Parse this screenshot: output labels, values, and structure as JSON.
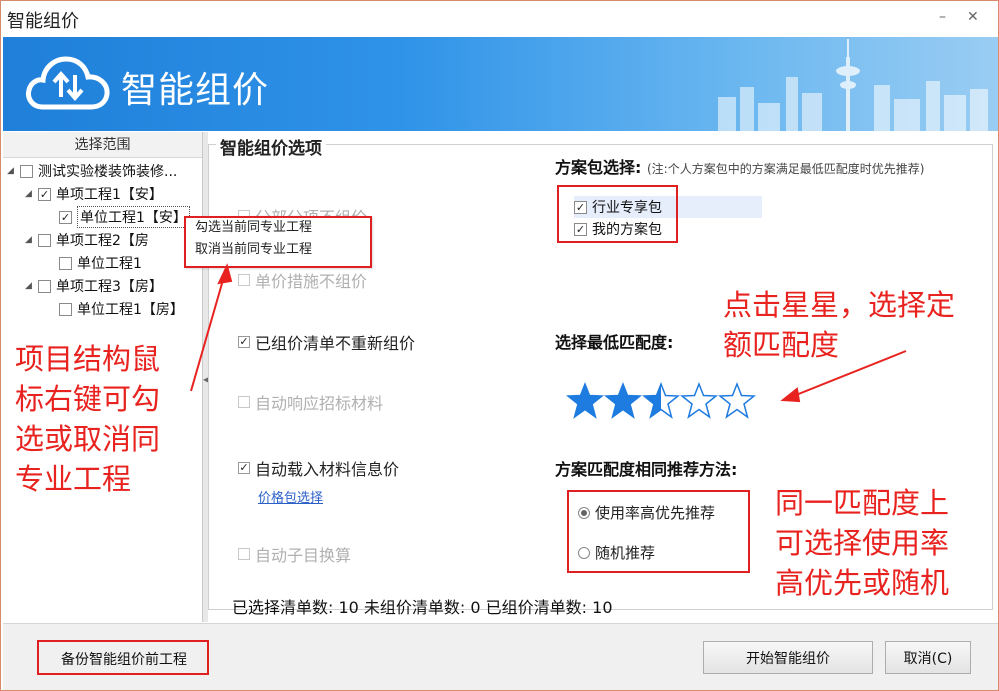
{
  "window": {
    "title": "智能组价",
    "min_icon": "minimize-icon",
    "close_icon": "close-icon"
  },
  "banner": {
    "title": "智能组价",
    "logo_icon": "cloud-upload-download-icon"
  },
  "left_panel": {
    "header": "选择范围",
    "tree": [
      {
        "label": "测试实验楼装饰装修...",
        "checked": false
      },
      {
        "label": "单项工程1【安】",
        "checked": true
      },
      {
        "label": "单位工程1【安】",
        "checked": true
      },
      {
        "label": "单项工程2【房",
        "checked": false
      },
      {
        "label": "单位工程1",
        "checked": false
      },
      {
        "label": "单项工程3【房】",
        "checked": false
      },
      {
        "label": "单位工程1【房】",
        "checked": false
      }
    ],
    "context_menu": [
      "勾选当前同专业工程",
      "取消当前同专业工程"
    ]
  },
  "options": {
    "group_title": "智能组价选项",
    "items": [
      {
        "label": "分部分项不组价",
        "checked": false,
        "enabled": false
      },
      {
        "label": "单价措施不组价",
        "checked": false,
        "enabled": false
      },
      {
        "label": "已组价清单不重新组价",
        "checked": true,
        "enabled": true
      },
      {
        "label": "自动响应招标材料",
        "checked": false,
        "enabled": false
      },
      {
        "label": "自动载入材料信息价",
        "checked": true,
        "enabled": true
      },
      {
        "label": "自动子目换算",
        "checked": false,
        "enabled": false
      }
    ],
    "price_link": "价格包选择"
  },
  "package": {
    "title": "方案包选择:",
    "note": "(注:个人方案包中的方案满足最低匹配度时优先推荐)",
    "items": [
      {
        "label": "行业专享包",
        "checked": true
      },
      {
        "label": "我的方案包",
        "checked": true
      }
    ]
  },
  "match": {
    "title": "选择最低匹配度:",
    "rating": 2.5,
    "max": 5
  },
  "recommend": {
    "title": "方案匹配度相同推荐方法:",
    "options": [
      {
        "label": "使用率高优先推荐",
        "selected": true
      },
      {
        "label": "随机推荐",
        "selected": false
      }
    ]
  },
  "summary": "已选择清单数: 10 未组价清单数: 0 已组价清单数: 10",
  "buttons": {
    "backup": "备份智能组价前工程",
    "start": "开始智能组价",
    "cancel": "取消(C)"
  },
  "annotations": {
    "left_lines": [
      "项目结构鼠",
      "标右键可勾",
      "选或取消同",
      "专业工程"
    ],
    "stars_lines": [
      "点击星星，选择定",
      "额匹配度"
    ],
    "recommend_lines": [
      "同一匹配度上",
      "可选择使用率",
      "高优先或随机"
    ]
  },
  "colors": {
    "accent": "#2f93e8",
    "annotation": "#e8231f",
    "star": "#1e7be0"
  }
}
